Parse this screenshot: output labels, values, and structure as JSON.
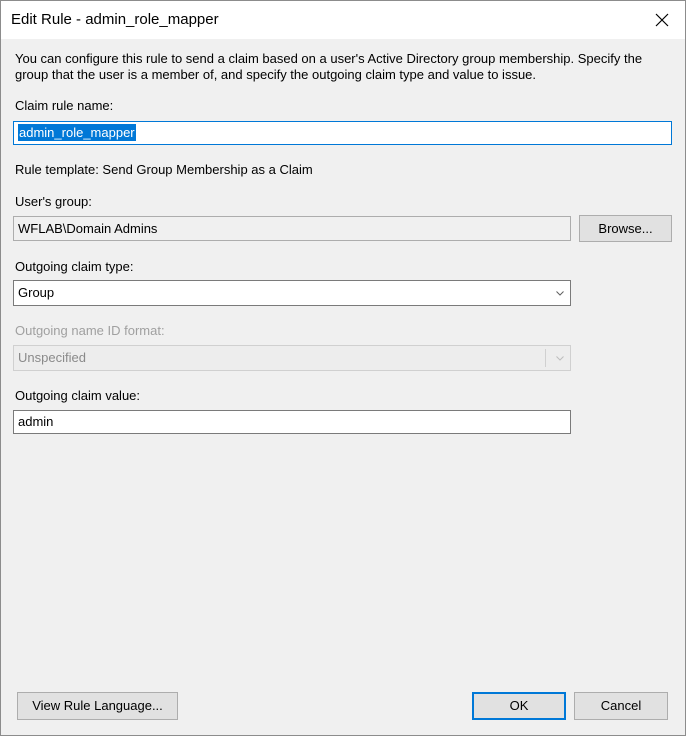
{
  "window": {
    "title": "Edit Rule - admin_role_mapper"
  },
  "description": "You can configure this rule to send a claim based on a user's Active Directory group membership. Specify the group that the user is a member of, and specify the outgoing claim type and value to issue.",
  "claim_rule_name": {
    "label": "Claim rule name:",
    "value": "admin_role_mapper"
  },
  "rule_template": "Rule template: Send Group Membership as a Claim",
  "users_group": {
    "label": "User's group:",
    "value": "WFLAB\\Domain Admins",
    "browse_label": "Browse..."
  },
  "outgoing_claim_type": {
    "label": "Outgoing claim type:",
    "selected": "Group"
  },
  "outgoing_name_id_format": {
    "label": "Outgoing name ID format:",
    "selected": "Unspecified"
  },
  "outgoing_claim_value": {
    "label": "Outgoing claim value:",
    "value": "admin"
  },
  "buttons": {
    "view_rule_language": "View Rule Language...",
    "ok": "OK",
    "cancel": "Cancel"
  }
}
